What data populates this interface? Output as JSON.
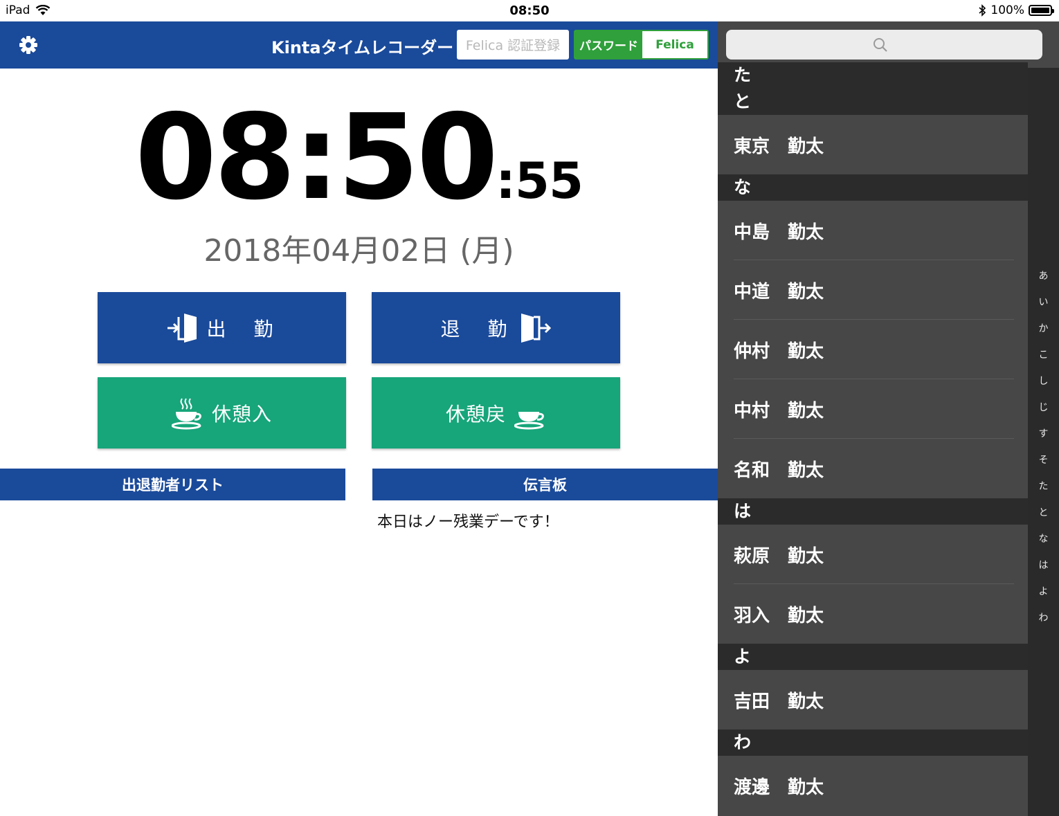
{
  "status_bar": {
    "device": "iPad",
    "time": "08:50",
    "battery": "100%"
  },
  "header": {
    "title": "Kintaタイムレコーダー",
    "felica_register_label": "Felica 認証登録",
    "mode_password": "パスワード",
    "mode_felica": "Felica"
  },
  "clock": {
    "hours_minutes": "08:50",
    "seconds": ":55",
    "date": "2018年04月02日 (月)"
  },
  "buttons": {
    "clock_in": "出　勤",
    "clock_out": "退　勤",
    "break_start": "休憩入",
    "break_end": "休憩戻"
  },
  "sections": {
    "attendance_list": "出退勤者リスト",
    "message_board": "伝言板",
    "message": "本日はノー残業デーです！"
  },
  "directory": {
    "rows": [
      {
        "type": "header",
        "label": "た"
      },
      {
        "type": "header",
        "label": "と"
      },
      {
        "type": "name",
        "label": "東京　勤太"
      },
      {
        "type": "header",
        "label": "な"
      },
      {
        "type": "name",
        "label": "中島　勤太"
      },
      {
        "type": "name",
        "label": "中道　勤太"
      },
      {
        "type": "name",
        "label": "仲村　勤太"
      },
      {
        "type": "name",
        "label": "中村　勤太"
      },
      {
        "type": "name",
        "label": "名和　勤太"
      },
      {
        "type": "header",
        "label": "は"
      },
      {
        "type": "name",
        "label": "萩原　勤太"
      },
      {
        "type": "name",
        "label": "羽入　勤太"
      },
      {
        "type": "header",
        "label": "よ"
      },
      {
        "type": "name",
        "label": "吉田　勤太"
      },
      {
        "type": "header",
        "label": "わ"
      },
      {
        "type": "name",
        "label": "渡邊　勤太"
      }
    ],
    "index": [
      "あ",
      "い",
      "か",
      "こ",
      "し",
      "じ",
      "す",
      "そ",
      "た",
      "と",
      "な",
      "は",
      "よ",
      "わ"
    ]
  },
  "colors": {
    "header_blue": "#1a4a9a",
    "break_green": "#17a57a",
    "toggle_green": "#2fa03b",
    "list_bg": "#474747",
    "section_header_bg": "#2b2b2b"
  }
}
